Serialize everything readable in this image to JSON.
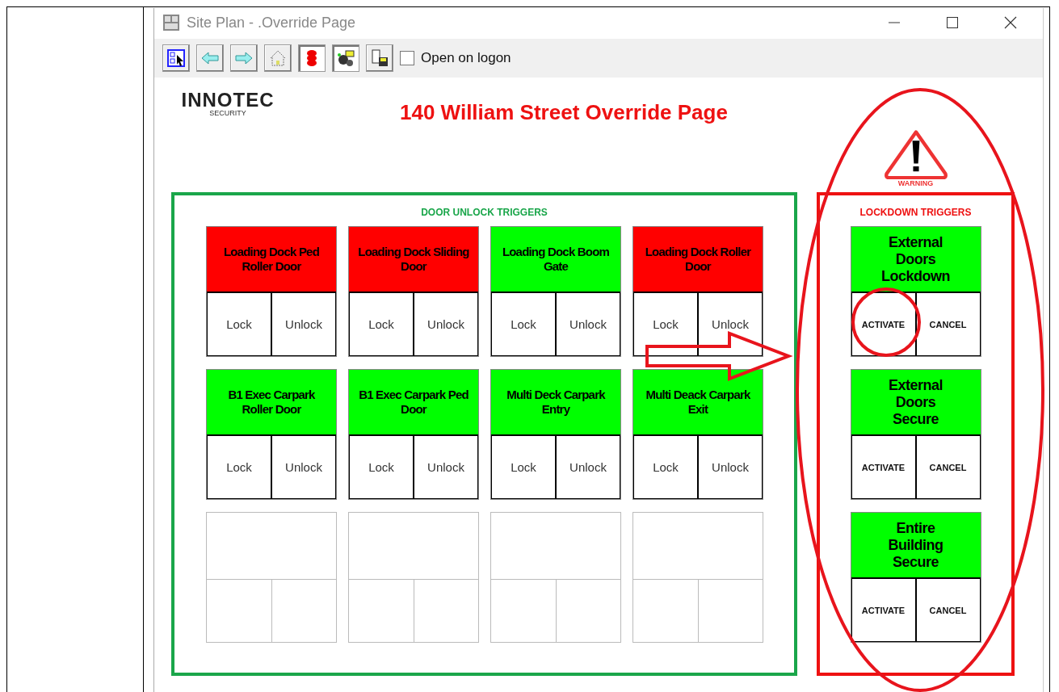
{
  "window": {
    "title": "Site Plan - .Override Page"
  },
  "toolbar": {
    "checkbox": {
      "label": "Open on logon",
      "checked": false
    }
  },
  "logo": {
    "name": "INNOTEC",
    "tagline": "SECURITY"
  },
  "page_title": "140 William Street Override Page",
  "warning_sign": {
    "label": "WARNING"
  },
  "door_unlock": {
    "title": "DOOR UNLOCK TRIGGERS",
    "doors": [
      {
        "kind": "door",
        "name": "Loading Dock Ped Roller Door",
        "color": "#ff0000",
        "buttons": [
          "Lock",
          "Unlock"
        ]
      },
      {
        "kind": "door",
        "name": "Loading Dock Sliding Door",
        "color": "#ff0000",
        "buttons": [
          "Lock",
          "Unlock"
        ]
      },
      {
        "kind": "door",
        "name": "Loading Dock Boom Gate",
        "color": "#00ff00",
        "buttons": [
          "Lock",
          "Unlock"
        ]
      },
      {
        "kind": "door",
        "name": "Loading Dock Roller Door",
        "color": "#ff0000",
        "buttons": [
          "Lock",
          "Unlock"
        ]
      },
      {
        "kind": "door",
        "name": "B1 Exec Carpark Roller Door",
        "color": "#00ff00",
        "buttons": [
          "Lock",
          "Unlock"
        ]
      },
      {
        "kind": "door",
        "name": "B1 Exec Carpark Ped Door",
        "color": "#00ff00",
        "buttons": [
          "Lock",
          "Unlock"
        ]
      },
      {
        "kind": "door",
        "name": "Multi Deck Carpark Entry",
        "color": "#00ff00",
        "buttons": [
          "Lock",
          "Unlock"
        ]
      },
      {
        "kind": "door",
        "name": "Multi Deack Carpark Exit",
        "color": "#00ff00",
        "buttons": [
          "Lock",
          "Unlock"
        ]
      },
      {
        "kind": "empty"
      },
      {
        "kind": "empty"
      },
      {
        "kind": "empty"
      },
      {
        "kind": "empty"
      }
    ]
  },
  "lockdown": {
    "title": "LOCKDOWN TRIGGERS",
    "triggers": [
      {
        "name": "External Doors Lockdown",
        "color": "#00ff00",
        "buttons": [
          "ACTIVATE",
          "CANCEL"
        ]
      },
      {
        "name": "External Doors Secure",
        "color": "#00ff00",
        "buttons": [
          "ACTIVATE",
          "CANCEL"
        ]
      },
      {
        "name": "Entire Building Secure",
        "color": "#00ff00",
        "buttons": [
          "ACTIVATE",
          "CANCEL"
        ]
      }
    ]
  }
}
